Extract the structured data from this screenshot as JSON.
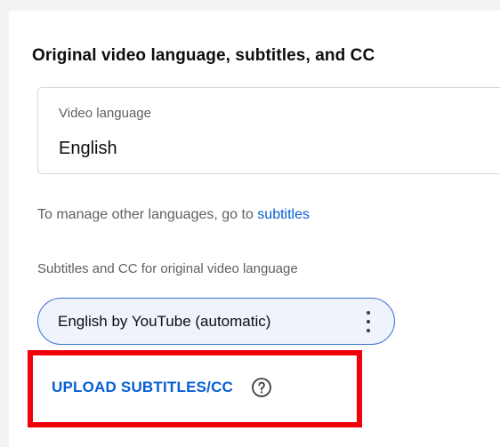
{
  "section": {
    "title": "Original video language, subtitles, and CC"
  },
  "video_language": {
    "label": "Video language",
    "value": "English"
  },
  "manage": {
    "text": "To manage other languages, go to ",
    "link": "subtitles"
  },
  "subtitles_cc": {
    "label": "Subtitles and CC for original video language",
    "chip_label": "English by YouTube (automatic)",
    "chip_menu_icon": "more-vert-icon"
  },
  "upload": {
    "label": "UPLOAD SUBTITLES/CC",
    "help_icon": "help-circle-icon"
  },
  "colors": {
    "link_blue": "#065fd4",
    "highlight_red": "#f2000a",
    "chip_border": "#3e6ed1"
  }
}
